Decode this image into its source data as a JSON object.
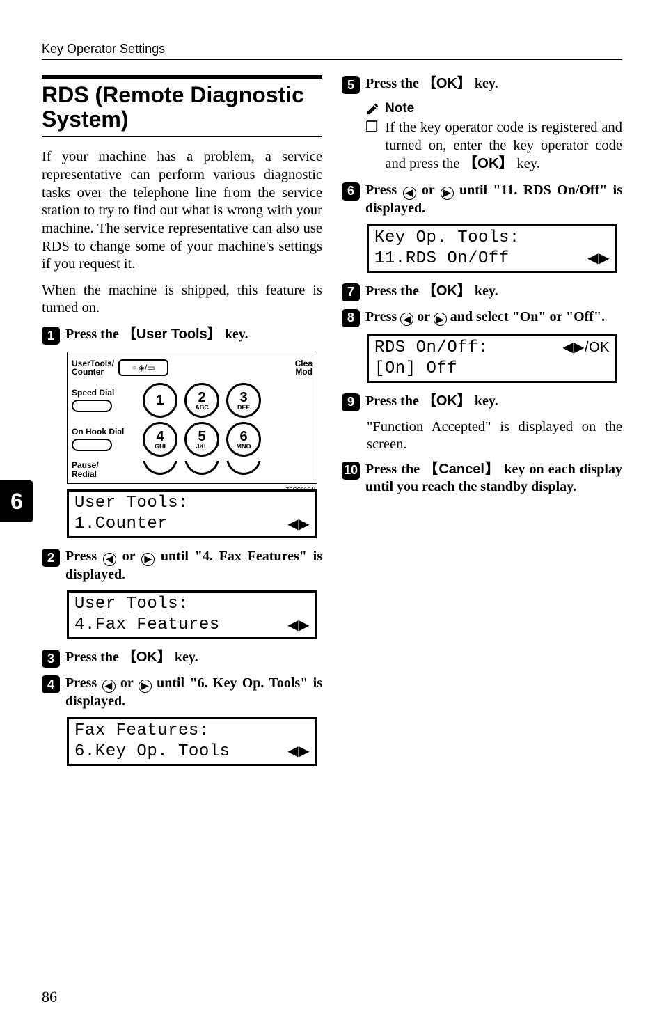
{
  "header": "Key Operator Settings",
  "tab": "6",
  "page_num": "86",
  "title": "RDS (Remote Diagnostic System)",
  "intro1": "If your machine has a problem, a service representative can perform various diagnostic tasks over the telephone line from the service station to try to find out what is wrong with your machine. The service representative can also use RDS to change some of your machine's settings if you request it.",
  "intro2": "When the machine is shipped, this feature is turned on.",
  "steps": {
    "s1": {
      "pre": "Press the ",
      "key": "User Tools",
      "post": " key."
    },
    "s2": {
      "pre": "Press ",
      "mid": " or ",
      "post": " until \"4. Fax Features\" is displayed."
    },
    "s3": {
      "pre": "Press the ",
      "key": "OK",
      "post": " key."
    },
    "s4": {
      "pre": "Press ",
      "mid": " or ",
      "post": " until \"6. Key Op. Tools\" is displayed."
    },
    "s5": {
      "pre": "Press the ",
      "key": "OK",
      "post": " key."
    },
    "s6": {
      "pre": "Press ",
      "mid": " or ",
      "post": " until \"11. RDS On/Off\" is displayed."
    },
    "s7": {
      "pre": "Press the ",
      "key": "OK",
      "post": " key."
    },
    "s8": {
      "pre": "Press ",
      "mid": " or ",
      "post": " and select \"On\" or \"Off\"."
    },
    "s9": {
      "pre": "Press the ",
      "key": "OK",
      "post": " key."
    },
    "s10": {
      "pre": "Press the ",
      "key": "Cancel",
      "post": " key on each display until you reach the standby display."
    }
  },
  "note": {
    "label": "Note",
    "item": "If the key operator code is registered and turned on, enter the key operator code and press the ",
    "key": "OK",
    "tail": " key."
  },
  "keypad": {
    "ut_label1": "UserTools/",
    "ut_label2": "Counter",
    "ut_btn": "◇/123",
    "clea1": "Clea",
    "clea2": "Mod",
    "speed": "Speed Dial",
    "onhook": "On Hook Dial",
    "pause1": "Pause/",
    "pause2": "Redial",
    "digits": [
      {
        "big": "1",
        "sm": ""
      },
      {
        "big": "2",
        "sm": "ABC"
      },
      {
        "big": "3",
        "sm": "DEF"
      },
      {
        "big": "4",
        "sm": "GHI"
      },
      {
        "big": "5",
        "sm": "JKL"
      },
      {
        "big": "6",
        "sm": "MNO"
      }
    ],
    "tag": "ZEGS06GN"
  },
  "lcd": {
    "l1a": "User Tools:",
    "l1b": "1.Counter",
    "l2a": "User Tools:",
    "l2b": "4.Fax Features",
    "l3a": "Fax Features:",
    "l3b": "6.Key Op. Tools",
    "l4a": "Key Op. Tools:",
    "l4b": "11.RDS On/Off",
    "l5a": "RDS On/Off:",
    "l5b": " [On]   Off",
    "lr_arrow": "◀▶",
    "lr_ok": "◀▶/OK"
  },
  "accepted": "\"Function Accepted\" is displayed on the screen."
}
